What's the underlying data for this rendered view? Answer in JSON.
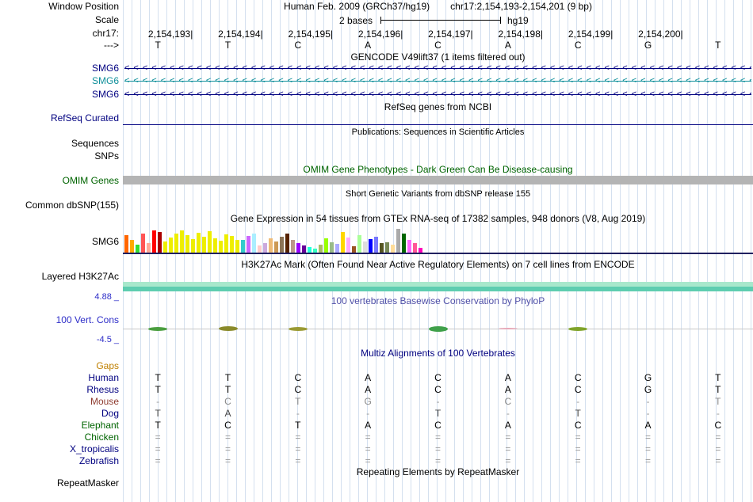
{
  "header": {
    "window_position_label": "Window Position",
    "assembly_text": "Human Feb. 2009 (GRCh37/hg19)",
    "position_text": "chr17:2,154,193-2,154,201 (9 bp)",
    "scale_label": "Scale",
    "scale_text": "2 bases",
    "assembly_short": "hg19",
    "chrom_label": "chr17:",
    "strand_label": "--->",
    "coordinates": [
      "2,154,193",
      "2,154,194",
      "2,154,195",
      "2,154,196",
      "2,154,197",
      "2,154,198",
      "2,154,199",
      "2,154,200"
    ],
    "bases": [
      "T",
      "T",
      "C",
      "A",
      "C",
      "A",
      "C",
      "G",
      "T"
    ]
  },
  "tracks": {
    "gencode": {
      "title": "GENCODE V49lift37 (1 items filtered out)",
      "arrow": "<",
      "arrow_count": 72,
      "items": [
        {
          "label": "SMG6",
          "color": "#000080"
        },
        {
          "label": "SMG6",
          "color": "#0f8f9a"
        },
        {
          "label": "SMG6",
          "color": "#000080"
        }
      ]
    },
    "refseq": {
      "title": "RefSeq genes from NCBI",
      "label": "RefSeq Curated",
      "color": "#000080"
    },
    "publications": {
      "title": "Publications: Sequences in Scientific Articles",
      "row1_label": "Sequences",
      "row2_label": "SNPs"
    },
    "omim": {
      "title": "OMIM Gene Phenotypes - Dark Green Can Be Disease-causing",
      "label": "OMIM Genes",
      "color": "#006400",
      "bar_color": "#b4b4b4"
    },
    "dbsnp": {
      "title": "Short Genetic Variants from dbSNP release 155",
      "label": "Common dbSNP(155)"
    },
    "gtex": {
      "title": "Gene Expression in 54 tissues from GTEx RNA-seq of 17382 samples, 948 donors (V8, Aug 2019)",
      "label": "SMG6",
      "baseline_color": "#202060",
      "bars": [
        [
          "#ff6600",
          22
        ],
        [
          "#ffaa00",
          16
        ],
        [
          "#33dd33",
          10
        ],
        [
          "#ff5555",
          24
        ],
        [
          "#ffaa99",
          12
        ],
        [
          "#ff0000",
          28
        ],
        [
          "#aa0000",
          26
        ],
        [
          "#eeee00",
          14
        ],
        [
          "#eeee00",
          19
        ],
        [
          "#eeee00",
          24
        ],
        [
          "#eeee00",
          28
        ],
        [
          "#eeee00",
          22
        ],
        [
          "#eeee00",
          17
        ],
        [
          "#eeee00",
          25
        ],
        [
          "#eeee00",
          20
        ],
        [
          "#eeee00",
          27
        ],
        [
          "#eeee00",
          18
        ],
        [
          "#eeee00",
          15
        ],
        [
          "#eeee00",
          23
        ],
        [
          "#eeee00",
          21
        ],
        [
          "#eeee00",
          16
        ],
        [
          "#33cccc",
          16
        ],
        [
          "#cc66ff",
          21
        ],
        [
          "#aaeeff",
          24
        ],
        [
          "#ffcccc",
          9
        ],
        [
          "#ccaadd",
          12
        ],
        [
          "#eebb77",
          18
        ],
        [
          "#cc9955",
          14
        ],
        [
          "#8b7355",
          20
        ],
        [
          "#552200",
          24
        ],
        [
          "#bb9988",
          16
        ],
        [
          "#9900ff",
          12
        ],
        [
          "#660099",
          9
        ],
        [
          "#22ffdd",
          7
        ],
        [
          "#33ffc2",
          5
        ],
        [
          "#aabb66",
          10
        ],
        [
          "#99ff00",
          18
        ],
        [
          "#99bb88",
          13
        ],
        [
          "#aaaaff",
          11
        ],
        [
          "#ffd700",
          26
        ],
        [
          "#ffaaff",
          19
        ],
        [
          "#995522",
          8
        ],
        [
          "#aaff99",
          22
        ],
        [
          "#dddddd",
          14
        ],
        [
          "#0000ff",
          17
        ],
        [
          "#7777ff",
          20
        ],
        [
          "#555522",
          12
        ],
        [
          "#778855",
          13
        ],
        [
          "#ffdd99",
          10
        ],
        [
          "#aaaaaa",
          30
        ],
        [
          "#006600",
          24
        ],
        [
          "#ff66ff",
          16
        ],
        [
          "#ff5599",
          12
        ],
        [
          "#ff00bb",
          6
        ]
      ]
    },
    "h3k27ac": {
      "title": "H3K27Ac Mark (Often Found Near Active Regulatory Elements) on 7 cell lines from ENCODE",
      "label": "Layered H3K27Ac",
      "top_color": "#a8e8cc",
      "bottom_color": "#5ecdb0"
    },
    "conservation": {
      "title": "100 vertebrates Basewise Conservation by PhyloP",
      "title_color": "#5050a8",
      "label": "100 Vert. Cons",
      "label_color": "#2d2dc8",
      "max_label": "4.88 _",
      "min_label": "-4.5 _",
      "baseline_color": "#c8c8c8",
      "blips": [
        {
          "col": 0,
          "color": "#4a9e3f",
          "h": 5
        },
        {
          "col": 1,
          "color": "#8a8a2a",
          "h": 6
        },
        {
          "col": 2,
          "color": "#9a9a33",
          "h": 5
        },
        {
          "col": 4,
          "color": "#3fa04a",
          "h": 7
        },
        {
          "col": 5,
          "color": "#e8a8b8",
          "h": 2
        },
        {
          "col": 6,
          "color": "#7fa32a",
          "h": 5
        }
      ]
    },
    "multiz": {
      "title": "Multiz Alignments of 100 Vertebrates",
      "title_color": "#000080",
      "rows": [
        {
          "label": "Gaps",
          "label_color": "#c08000",
          "letter_color": "#999999",
          "cells": [
            "",
            "",
            "",
            "",
            "",
            "",
            "",
            "",
            ""
          ]
        },
        {
          "label": "Human",
          "label_color": "#000080",
          "letter_color": "#000000",
          "cells": [
            "T",
            "T",
            "C",
            "A",
            "C",
            "A",
            "C",
            "G",
            "T"
          ]
        },
        {
          "label": "Rhesus",
          "label_color": "#000080",
          "letter_color": "#000000",
          "cells": [
            "T",
            "T",
            "C",
            "A",
            "C",
            "A",
            "C",
            "G",
            "T"
          ]
        },
        {
          "label": "Mouse",
          "label_color": "#8e3b2f",
          "letter_color": "#8a8a8a",
          "cells": [
            "-",
            "C",
            "T",
            "G",
            "-",
            "C",
            "-",
            "-",
            "T"
          ]
        },
        {
          "label": "Dog",
          "label_color": "#000080",
          "letter_color": "#444444",
          "cells": [
            "T",
            "A",
            "-",
            "-",
            "T",
            "-",
            "T",
            "-",
            "-"
          ]
        },
        {
          "label": "Elephant",
          "label_color": "#006400",
          "letter_color": "#000000",
          "cells": [
            "T",
            "C",
            "T",
            "A",
            "C",
            "A",
            "C",
            "A",
            "C"
          ]
        },
        {
          "label": "Chicken",
          "label_color": "#006400",
          "letter_color": "#8a8a8a",
          "cells": [
            "=",
            "=",
            "=",
            "=",
            "=",
            "=",
            "=",
            "=",
            "="
          ]
        },
        {
          "label": "X_tropicalis",
          "label_color": "#000080",
          "letter_color": "#8a8a8a",
          "cells": [
            "=",
            "=",
            "=",
            "=",
            "=",
            "=",
            "=",
            "=",
            "="
          ]
        },
        {
          "label": "Zebrafish",
          "label_color": "#000080",
          "letter_color": "#8a8a8a",
          "cells": [
            "=",
            "=",
            "=",
            "=",
            "=",
            "=",
            "=",
            "=",
            "="
          ]
        }
      ]
    },
    "repeatmasker": {
      "title": "Repeating Elements by RepeatMasker",
      "label": "RepeatMasker"
    }
  }
}
